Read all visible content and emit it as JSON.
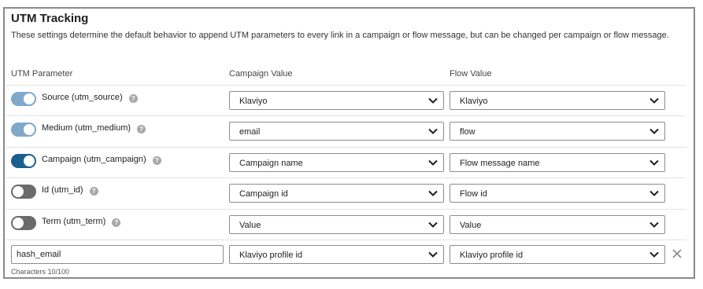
{
  "section": {
    "title": "UTM Tracking",
    "description": "These settings determine the default behavior to append UTM parameters to every link in a campaign or flow message, but can be changed per campaign or flow message."
  },
  "columns": {
    "parameter": "UTM Parameter",
    "campaign": "Campaign Value",
    "flow": "Flow Value"
  },
  "colors": {
    "toggle_on_dark": "#1a5f8e",
    "toggle_on_light": "#7fa9c9",
    "toggle_off": "#6b6b6b"
  },
  "rows": [
    {
      "label": "Source (utm_source)",
      "enabled": true,
      "toggle_style": "light",
      "help_icon": "question-circle-icon",
      "campaign_value": "Klaviyo",
      "flow_value": "Klaviyo"
    },
    {
      "label": "Medium (utm_medium)",
      "enabled": true,
      "toggle_style": "light",
      "help_icon": "question-circle-icon",
      "campaign_value": "email",
      "flow_value": "flow"
    },
    {
      "label": "Campaign (utm_campaign)",
      "enabled": true,
      "toggle_style": "dark",
      "help_icon": "question-circle-icon",
      "campaign_value": "Campaign name",
      "flow_value": "Flow message name"
    },
    {
      "label": "Id (utm_id)",
      "enabled": false,
      "toggle_style": "off",
      "help_icon": "question-circle-icon",
      "campaign_value": "Campaign id",
      "flow_value": "Flow id"
    },
    {
      "label": "Term (utm_term)",
      "enabled": false,
      "toggle_style": "off",
      "help_icon": "question-circle-icon",
      "campaign_value": "Value",
      "flow_value": "Value"
    }
  ],
  "custom_row": {
    "name_value": "hash_email",
    "campaign_value": "Klaviyo profile id",
    "flow_value": "Klaviyo profile id",
    "char_count": "Characters 10/100",
    "remove_icon": "close-icon"
  }
}
